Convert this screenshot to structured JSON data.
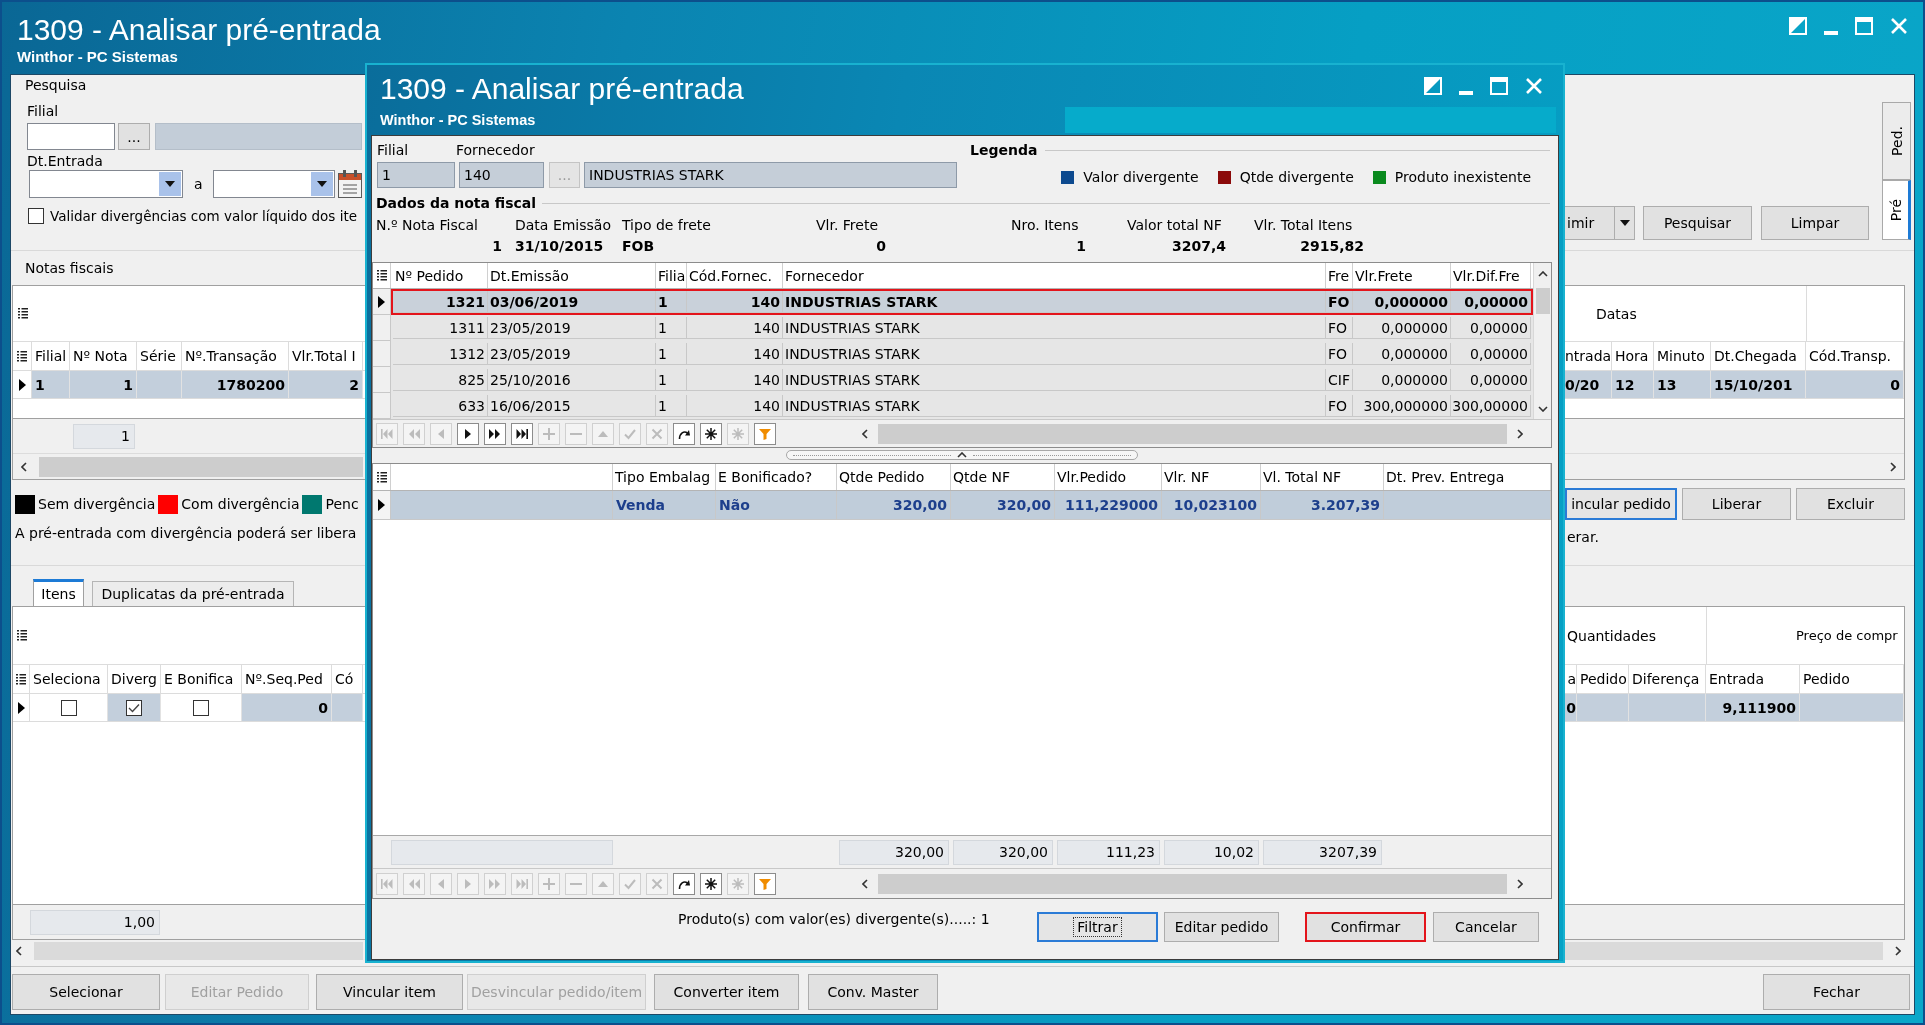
{
  "window": {
    "title": "1309 - Analisar pré-entrada",
    "subtitle": "Winthor - PC Sistemas"
  },
  "search": {
    "title": "Pesquisa",
    "filial_label": "Filial",
    "filial_button": "...",
    "date_label": "Dt.Entrada",
    "date_separator": "a",
    "validate": {
      "label": "Validar divergências com valor líquido dos ite",
      "checked": false
    },
    "buttons": [
      {
        "label": "imir",
        "kind": "split"
      },
      {
        "label": "Pesquisar",
        "kind": "plain"
      },
      {
        "label": "Limpar",
        "kind": "plain"
      }
    ]
  },
  "side_tabs": [
    {
      "label": "Ped.",
      "selected": false
    },
    {
      "label": "Pré",
      "selected": true
    }
  ],
  "notas": {
    "title": "Notas fiscais",
    "band": "Datas",
    "columns_left": [
      "Filial",
      "Nº Nota",
      "Série",
      "Nº.Transação",
      "Vlr.Total I"
    ],
    "columns_right": [
      "ntrada",
      "Hora",
      "Minuto",
      "Dt.Chegada",
      "Cód.Transp."
    ],
    "rows": [
      {
        "selected": true,
        "left": {
          "c0": "1",
          "c1": "1",
          "c3": "1780200",
          "c4": "2"
        },
        "right": {
          "c0": "0/20",
          "c1": "12",
          "c2": "13",
          "c3": "15/10/201",
          "c4": "0"
        }
      }
    ],
    "footer": "1"
  },
  "legend": [
    {
      "label": "Sem divergência",
      "color": "#000000"
    },
    {
      "label": "Com divergência",
      "color": "#ff0000"
    },
    {
      "label": "Penc",
      "color": "#00786f"
    }
  ],
  "message": {
    "left": "A pré-entrada com divergência poderá ser libera",
    "right": "erar."
  },
  "row_buttons": [
    {
      "label": "incular pedido",
      "focused": true
    },
    {
      "label": "Liberar",
      "focused": false
    },
    {
      "label": "Excluir",
      "focused": false
    }
  ],
  "tabs": [
    {
      "label": "Itens",
      "selected": true
    },
    {
      "label": "Duplicatas da pré-entrada",
      "selected": false
    }
  ],
  "items": {
    "bands": [
      "Quantidades",
      "Preço de compr"
    ],
    "columns_left": [
      "Seleciona",
      "Diverg",
      "E Bonifica",
      "Nº.Seq.Ped",
      "Có"
    ],
    "columns_right": [
      "a",
      "Pedido",
      "Diferença",
      "Entrada",
      "Pedido"
    ],
    "rows": [
      {
        "selected": true,
        "left": [
          {
            "kind": "check",
            "checked": false
          },
          {
            "kind": "check",
            "checked": true
          },
          {
            "kind": "check",
            "checked": false
          },
          {
            "kind": "text",
            "text": "0"
          }
        ],
        "right": {
          "c0": "0",
          "c3": "9,111900"
        }
      }
    ],
    "footer": "1,00"
  },
  "bottom_buttons": [
    {
      "label": "Selecionar",
      "disabled": false
    },
    {
      "label": "Editar Pedido",
      "disabled": true
    },
    {
      "label": "Vincular item",
      "disabled": false
    },
    {
      "label": "Desvincular pedido/item",
      "disabled": true
    },
    {
      "label": "Converter item",
      "disabled": false
    },
    {
      "label": "Conv. Master",
      "disabled": false
    }
  ],
  "close_button": "Fechar",
  "dialog": {
    "title": "1309 - Analisar pré-entrada",
    "subtitle": "Winthor - PC Sistemas",
    "filial": {
      "label": "Filial",
      "value": "1"
    },
    "fornecedor": {
      "label": "Fornecedor",
      "code": "140",
      "button": {
        "label": "...",
        "disabled": true
      },
      "name": "INDUSTRIAS STARK"
    },
    "legend": {
      "title": "Legenda",
      "items": [
        {
          "label": "Valor divergente",
          "color": "#0d4a8f"
        },
        {
          "label": "Qtde divergente",
          "color": "#8b0a0a"
        },
        {
          "label": "Produto inexistente",
          "color": "#0a8a1e"
        }
      ]
    },
    "nota": {
      "title": "Dados da nota fiscal",
      "fields": [
        {
          "label": "N.º Nota Fiscal",
          "value": "1"
        },
        {
          "label": "Data Emissão",
          "value": "31/10/2015"
        },
        {
          "label": "Tipo de frete",
          "value": "FOB"
        },
        {
          "label": "Vlr. Frete",
          "value": "0"
        },
        {
          "label": "Nro. Itens",
          "value": "1"
        },
        {
          "label": "Valor total NF",
          "value": "3207,4"
        },
        {
          "label": "Vlr. Total Itens",
          "value": "2915,82"
        }
      ]
    },
    "pedidos": {
      "columns": [
        "Nº Pedido",
        "Dt.Emissão",
        "Filia",
        "Cód.Fornec.",
        "Fornecedor",
        "Fre",
        "Vlr.Frete",
        "Vlr.Dif.Fre"
      ],
      "rows": [
        {
          "selected": true,
          "highlighted": true,
          "cells": [
            "1321",
            "03/06/2019",
            "1",
            "140",
            "INDUSTRIAS STARK",
            "FO",
            "0,000000",
            "0,00000"
          ]
        },
        {
          "selected": false,
          "highlighted": false,
          "cells": [
            "1311",
            "23/05/2019",
            "1",
            "140",
            "INDUSTRIAS STARK",
            "FO",
            "0,000000",
            "0,00000"
          ]
        },
        {
          "selected": false,
          "highlighted": false,
          "cells": [
            "1312",
            "23/05/2019",
            "1",
            "140",
            "INDUSTRIAS STARK",
            "FO",
            "0,000000",
            "0,00000"
          ]
        },
        {
          "selected": false,
          "highlighted": false,
          "cells": [
            "825",
            "25/10/2016",
            "1",
            "140",
            "INDUSTRIAS STARK",
            "CIF",
            "0,000000",
            "0,00000"
          ]
        },
        {
          "selected": false,
          "highlighted": false,
          "cells": [
            "633",
            "16/06/2015",
            "1",
            "140",
            "INDUSTRIAS STARK",
            "FO",
            "300,000000",
            "300,00000"
          ]
        }
      ],
      "navigator": [
        {
          "kind": "first",
          "disabled": true
        },
        {
          "kind": "rewind",
          "disabled": true
        },
        {
          "kind": "prior",
          "disabled": true
        },
        {
          "kind": "next",
          "disabled": false
        },
        {
          "kind": "forward",
          "disabled": false
        },
        {
          "kind": "last",
          "disabled": false
        },
        {
          "kind": "insert",
          "disabled": true
        },
        {
          "kind": "delete",
          "disabled": true
        },
        {
          "kind": "edit",
          "disabled": true
        },
        {
          "kind": "post",
          "disabled": true
        },
        {
          "kind": "cancel",
          "disabled": true
        },
        {
          "kind": "refresh",
          "disabled": false
        },
        {
          "kind": "mark",
          "disabled": false
        },
        {
          "kind": "unmark",
          "disabled": true
        },
        {
          "kind": "filter",
          "disabled": false
        }
      ]
    },
    "itens": {
      "columns": [
        "Tipo Embalag",
        "E Bonificado?",
        "Qtde Pedido",
        "Qtde NF",
        "Vlr.Pedido",
        "Vlr. NF",
        "Vl. Total NF",
        "Dt. Prev. Entrega"
      ],
      "rows": [
        {
          "selected": true,
          "color": "#1d3f8c",
          "cells": [
            "Venda",
            "Não",
            "320,00",
            "320,00",
            "111,229000",
            "10,023100",
            "3.207,39"
          ]
        }
      ],
      "totals": {
        "c2": "320,00",
        "c3": "320,00",
        "c4": "111,23",
        "c5": "10,02",
        "c6": "3207,39"
      },
      "navigator": [
        {
          "kind": "first",
          "disabled": true
        },
        {
          "kind": "rewind",
          "disabled": true
        },
        {
          "kind": "prior",
          "disabled": true
        },
        {
          "kind": "next",
          "disabled": true
        },
        {
          "kind": "forward",
          "disabled": true
        },
        {
          "kind": "last",
          "disabled": true
        },
        {
          "kind": "insert",
          "disabled": true
        },
        {
          "kind": "delete",
          "disabled": true
        },
        {
          "kind": "edit",
          "disabled": true
        },
        {
          "kind": "post",
          "disabled": true
        },
        {
          "kind": "cancel",
          "disabled": true
        },
        {
          "kind": "refresh",
          "disabled": false
        },
        {
          "kind": "mark",
          "disabled": false
        },
        {
          "kind": "unmark",
          "disabled": true
        },
        {
          "kind": "filter",
          "disabled": false
        }
      ]
    },
    "status": "Produto(s) com valor(es) divergente(s).....: 1",
    "buttons": [
      {
        "label": "Filtrar",
        "focused": true,
        "highlighted": false
      },
      {
        "label": "Editar pedido",
        "focused": false,
        "highlighted": false
      },
      {
        "label": "Confirmar",
        "focused": false,
        "highlighted": true
      },
      {
        "label": "Cancelar",
        "focused": false,
        "highlighted": false
      }
    ]
  }
}
